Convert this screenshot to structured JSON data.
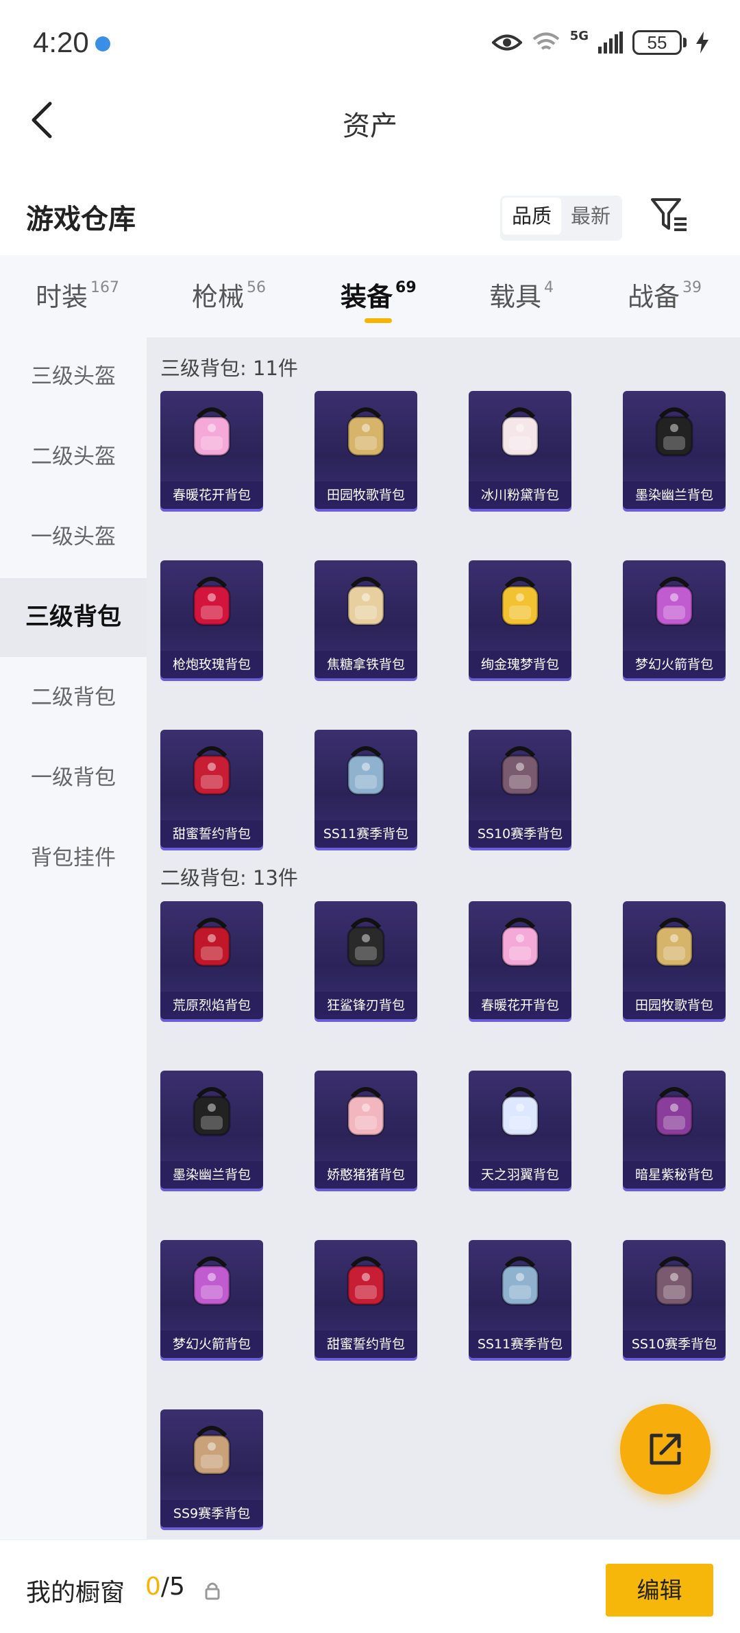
{
  "status_bar": {
    "time": "4:20",
    "network": "5G",
    "battery": "55"
  },
  "header": {
    "title": "资产"
  },
  "warehouse": {
    "title": "游戏仓库",
    "sort_options": [
      "品质",
      "最新"
    ],
    "active_sort": "品质"
  },
  "tabs": [
    {
      "label": "时装",
      "count": "167"
    },
    {
      "label": "枪械",
      "count": "56"
    },
    {
      "label": "装备",
      "count": "69"
    },
    {
      "label": "载具",
      "count": "4"
    },
    {
      "label": "战备",
      "count": "39"
    }
  ],
  "active_tab": "装备",
  "sidebar": {
    "items": [
      "三级头盔",
      "二级头盔",
      "一级头盔",
      "三级背包",
      "二级背包",
      "一级背包",
      "背包挂件"
    ],
    "active": "三级背包"
  },
  "groups": [
    {
      "title": "三级背包: 11件",
      "items": [
        {
          "name": "春暖花开背包",
          "icon": "butterfly-backpack-icon",
          "color": "#f4a9d8"
        },
        {
          "name": "田园牧歌背包",
          "icon": "basket-backpack-icon",
          "color": "#d6b46a"
        },
        {
          "name": "冰川粉黛背包",
          "icon": "bow-backpack-icon",
          "color": "#f5e6ea"
        },
        {
          "name": "墨染幽兰背包",
          "icon": "ink-backpack-icon",
          "color": "#222222"
        },
        {
          "name": "枪炮玫瑰背包",
          "icon": "rose-backpack-icon",
          "color": "#d3153d"
        },
        {
          "name": "焦糖拿铁背包",
          "icon": "latte-backpack-icon",
          "color": "#e8cfa0"
        },
        {
          "name": "绚金瑰梦背包",
          "icon": "gold-heart-backpack-icon",
          "color": "#f2c230"
        },
        {
          "name": "梦幻火箭背包",
          "icon": "rocket-backpack-icon",
          "color": "#c05bd0"
        },
        {
          "name": "甜蜜誓约背包",
          "icon": "heart-backpack-icon",
          "color": "#c81e35"
        },
        {
          "name": "SS11赛季背包",
          "icon": "season-backpack-icon",
          "color": "#8fb3cf"
        },
        {
          "name": "SS10赛季背包",
          "icon": "season-backpack-icon",
          "color": "#7a5a6e"
        }
      ]
    },
    {
      "title": "二级背包: 13件",
      "items": [
        {
          "name": "荒原烈焰背包",
          "icon": "flame-backpack-icon",
          "color": "#c0182a"
        },
        {
          "name": "狂鲨锋刃背包",
          "icon": "shark-backpack-icon",
          "color": "#2a2a2a"
        },
        {
          "name": "春暖花开背包",
          "icon": "butterfly-backpack-icon",
          "color": "#f4a9d8"
        },
        {
          "name": "田园牧歌背包",
          "icon": "basket-backpack-icon",
          "color": "#d6b46a"
        },
        {
          "name": "墨染幽兰背包",
          "icon": "ink-backpack-icon",
          "color": "#222222"
        },
        {
          "name": "娇憨猪猪背包",
          "icon": "pig-backpack-icon",
          "color": "#f2b6bf"
        },
        {
          "name": "天之羽翼背包",
          "icon": "wing-backpack-icon",
          "color": "#dde7ff"
        },
        {
          "name": "暗星紫秘背包",
          "icon": "dark-star-backpack-icon",
          "color": "#8a3d9a"
        },
        {
          "name": "梦幻火箭背包",
          "icon": "rocket-backpack-icon",
          "color": "#c05bd0"
        },
        {
          "name": "甜蜜誓约背包",
          "icon": "heart-backpack-icon",
          "color": "#c81e35"
        },
        {
          "name": "SS11赛季背包",
          "icon": "season-backpack-icon",
          "color": "#8fb3cf"
        },
        {
          "name": "SS10赛季背包",
          "icon": "season-backpack-icon",
          "color": "#7a5a6e"
        },
        {
          "name": "SS9赛季背包",
          "icon": "season-backpack-icon",
          "color": "#c9a27a"
        }
      ]
    }
  ],
  "showcase": {
    "label": "我的橱窗",
    "current": "0",
    "total": "/5"
  },
  "edit_label": "编辑",
  "colors": {
    "accent": "#f7b60a",
    "card_bg": "#2b2358",
    "card_border": "#6a5fd8"
  }
}
